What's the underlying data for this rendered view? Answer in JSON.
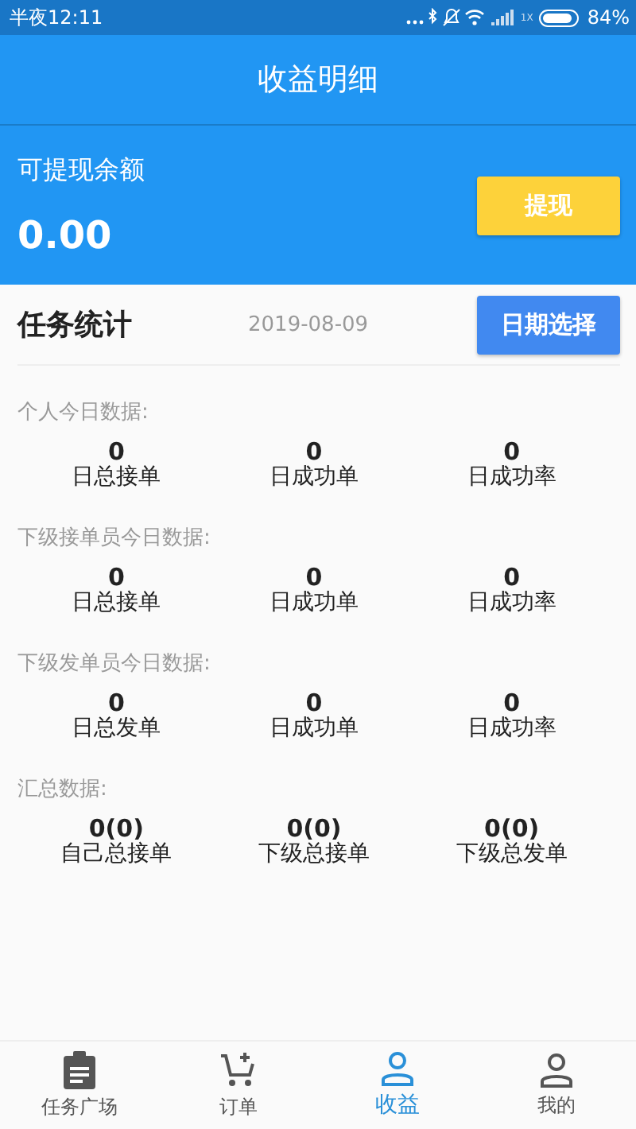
{
  "status_bar": {
    "time": "半夜12:11",
    "network": "1X",
    "battery": "84%"
  },
  "header": {
    "title": "收益明细"
  },
  "balance": {
    "label": "可提现余额",
    "amount": "0.00",
    "button": "提现"
  },
  "stats": {
    "title": "任务统计",
    "date": "2019-08-09",
    "date_button": "日期选择",
    "groups": [
      {
        "title": "个人今日数据:",
        "items": [
          {
            "value": "0",
            "label": "日总接单"
          },
          {
            "value": "0",
            "label": "日成功单"
          },
          {
            "value": "0",
            "label": "日成功率"
          }
        ]
      },
      {
        "title": "下级接单员今日数据:",
        "items": [
          {
            "value": "0",
            "label": "日总接单"
          },
          {
            "value": "0",
            "label": "日成功单"
          },
          {
            "value": "0",
            "label": "日成功率"
          }
        ]
      },
      {
        "title": "下级发单员今日数据:",
        "items": [
          {
            "value": "0",
            "label": "日总发单"
          },
          {
            "value": "0",
            "label": "日成功单"
          },
          {
            "value": "0",
            "label": "日成功率"
          }
        ]
      },
      {
        "title": "汇总数据:",
        "items": [
          {
            "value": "0(0)",
            "label": "自己总接单"
          },
          {
            "value": "0(0)",
            "label": "下级总接单"
          },
          {
            "value": "0(0)",
            "label": "下级总发单"
          }
        ]
      }
    ]
  },
  "tabs": [
    {
      "label": "任务广场",
      "kind": "clipboard",
      "selected": false
    },
    {
      "label": "订单",
      "kind": "cart",
      "selected": false
    },
    {
      "label": "收益",
      "kind": "person",
      "selected": true
    },
    {
      "label": "我的",
      "kind": "person",
      "selected": false
    }
  ]
}
